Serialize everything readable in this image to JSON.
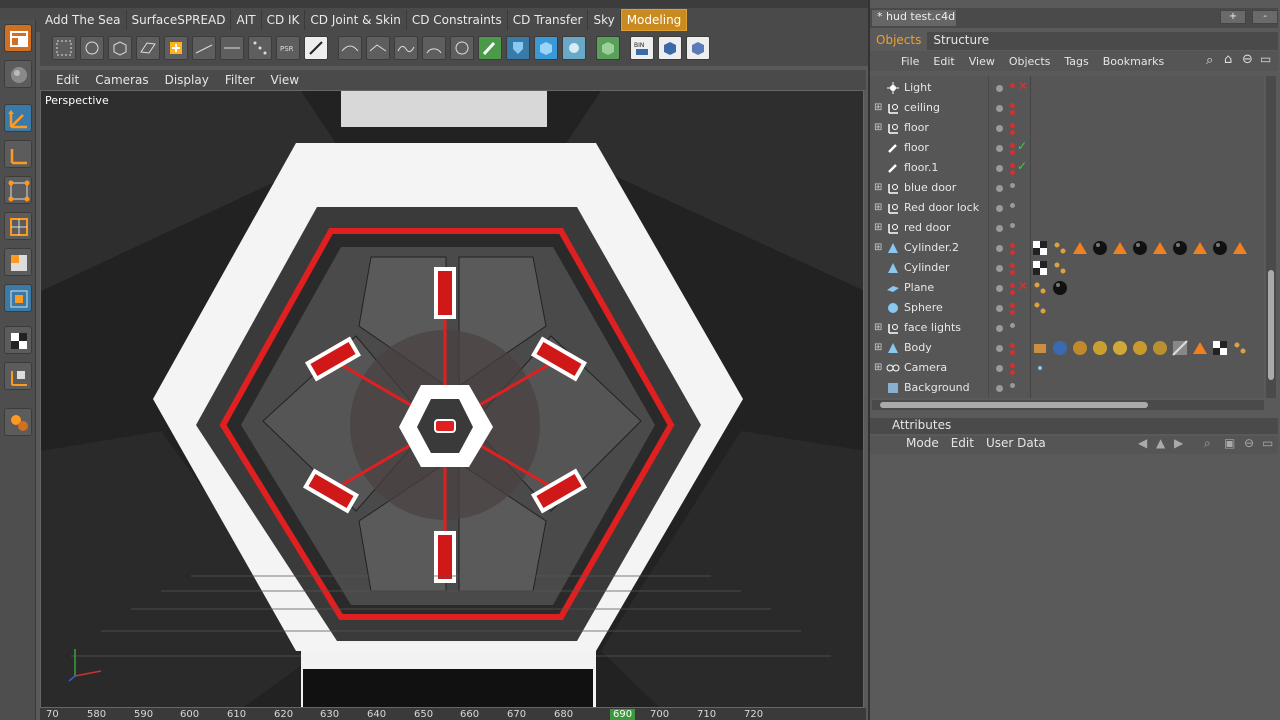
{
  "menubar": {
    "items": [
      "Add The Sea",
      "SurfaceSPREAD",
      "AIT",
      "CD IK",
      "CD Joint & Skin",
      "CD Constraints",
      "CD Transfer",
      "Sky",
      "Modeling"
    ],
    "active": "Modeling"
  },
  "viewport": {
    "menu": [
      "Edit",
      "Cameras",
      "Display",
      "Filter",
      "View"
    ],
    "label": "Perspective"
  },
  "timeline": {
    "ticks": [
      "70",
      "580",
      "590",
      "600",
      "610",
      "620",
      "630",
      "640",
      "650",
      "660",
      "670",
      "680",
      "690",
      "700",
      "710",
      "720"
    ],
    "current": "690"
  },
  "file": {
    "title": "* hud test.c4d",
    "add_label": "+",
    "remove_label": "-"
  },
  "objects_panel": {
    "tabs": [
      "Objects",
      "Structure"
    ],
    "active_tab": "Objects",
    "menu": [
      "File",
      "Edit",
      "View",
      "Objects",
      "Tags",
      "Bookmarks"
    ],
    "rows": [
      {
        "name": "Light",
        "icon": "light-icon"
      },
      {
        "name": "ceiling",
        "icon": "null-icon"
      },
      {
        "name": "floor",
        "icon": "null-icon"
      },
      {
        "name": "floor",
        "icon": "brush-icon"
      },
      {
        "name": "floor.1",
        "icon": "brush-icon"
      },
      {
        "name": "blue door",
        "icon": "null-icon"
      },
      {
        "name": "Red door lock",
        "icon": "null-icon"
      },
      {
        "name": "red door",
        "icon": "null-icon"
      },
      {
        "name": "Cylinder.2",
        "icon": "cylinder-icon"
      },
      {
        "name": "Cylinder",
        "icon": "cylinder-icon"
      },
      {
        "name": "Plane",
        "icon": "plane-icon"
      },
      {
        "name": "Sphere",
        "icon": "sphere-icon"
      },
      {
        "name": "face lights",
        "icon": "null-icon"
      },
      {
        "name": "Body",
        "icon": "polygon-icon"
      },
      {
        "name": "Camera",
        "icon": "camera-icon"
      },
      {
        "name": "Background",
        "icon": "background-icon"
      }
    ]
  },
  "attributes": {
    "title": "Attributes",
    "menu": [
      "Mode",
      "Edit",
      "User Data"
    ]
  },
  "colors": {
    "accent": "#c98a20",
    "active_tab_text": "#f0a030",
    "hud_red": "#e02020"
  }
}
